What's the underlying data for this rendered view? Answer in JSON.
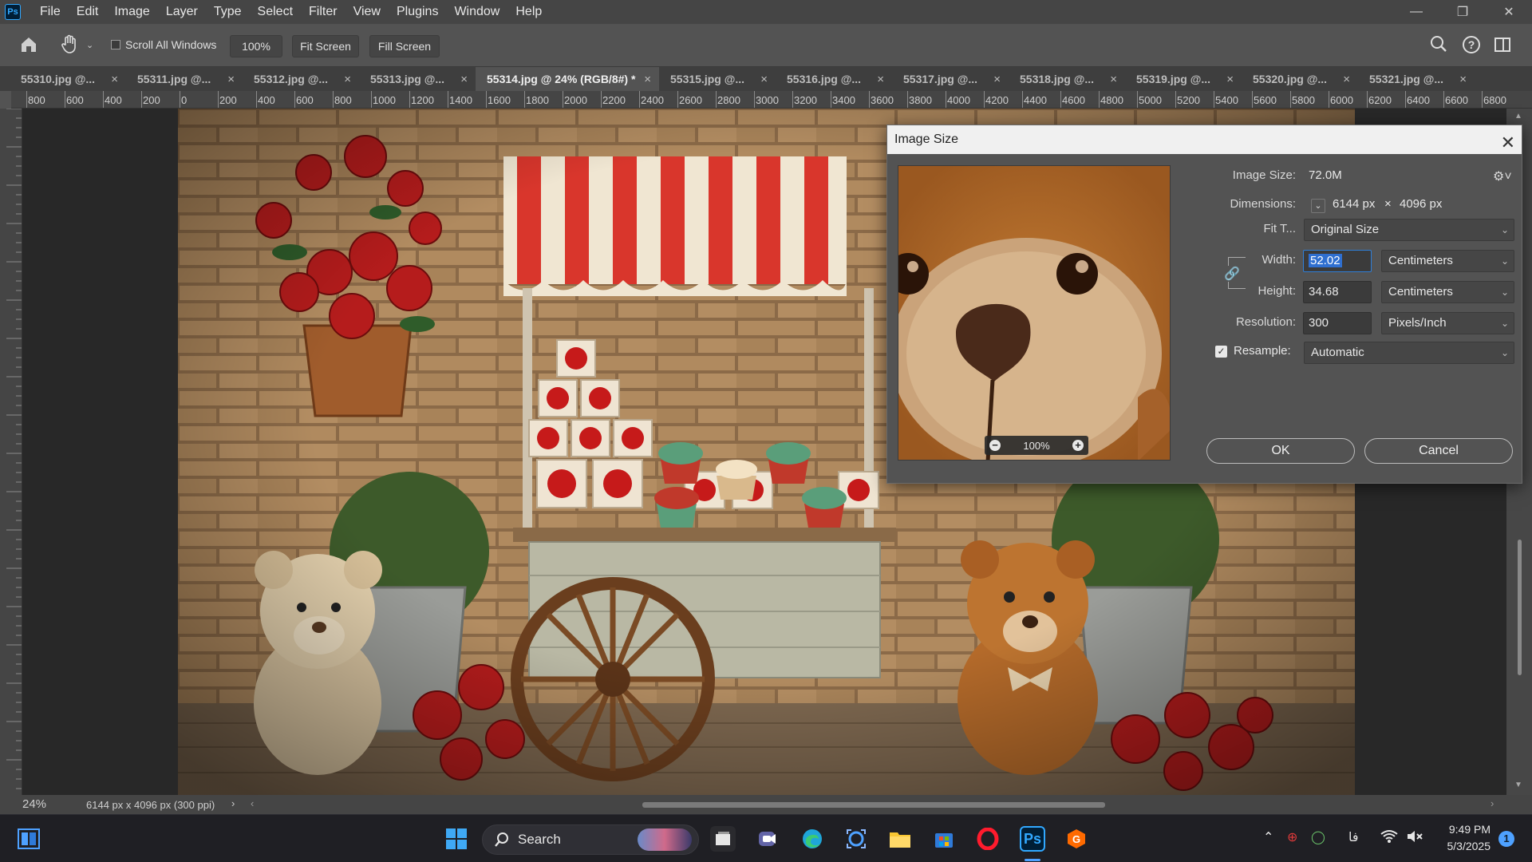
{
  "menubar": {
    "logo": "Ps",
    "items": [
      "File",
      "Edit",
      "Image",
      "Layer",
      "Type",
      "Select",
      "Filter",
      "View",
      "Plugins",
      "Window",
      "Help"
    ]
  },
  "options": {
    "scroll_all_windows": "Scroll All Windows",
    "zoom_100": "100%",
    "fit_screen": "Fit Screen",
    "fill_screen": "Fill Screen"
  },
  "tabs": [
    {
      "label": "55310.jpg @...",
      "active": false
    },
    {
      "label": "55311.jpg @...",
      "active": false
    },
    {
      "label": "55312.jpg @...",
      "active": false
    },
    {
      "label": "55313.jpg @...",
      "active": false
    },
    {
      "label": "55314.jpg @ 24% (RGB/8#) *",
      "active": true
    },
    {
      "label": "55315.jpg @...",
      "active": false
    },
    {
      "label": "55316.jpg @...",
      "active": false
    },
    {
      "label": "55317.jpg @...",
      "active": false
    },
    {
      "label": "55318.jpg @...",
      "active": false
    },
    {
      "label": "55319.jpg @...",
      "active": false
    },
    {
      "label": "55320.jpg @...",
      "active": false
    },
    {
      "label": "55321.jpg @...",
      "active": false
    }
  ],
  "ruler_h": [
    "800",
    "600",
    "400",
    "200",
    "0",
    "200",
    "400",
    "600",
    "800",
    "1000",
    "1200",
    "1400",
    "1600",
    "1800",
    "2000",
    "2200",
    "2400",
    "2600",
    "2800",
    "3000",
    "3200",
    "3400",
    "3600",
    "3800",
    "4000",
    "4200",
    "4400",
    "4600",
    "4800",
    "5000",
    "5200",
    "5400",
    "5600",
    "5800",
    "6000",
    "6200",
    "6400",
    "6600",
    "6800"
  ],
  "status": {
    "zoom": "24%",
    "doc_info": "6144 px x 4096 px (300 ppi)"
  },
  "dialog": {
    "title": "Image Size",
    "image_size_label": "Image Size:",
    "image_size_value": "72.0M",
    "dimensions_label": "Dimensions:",
    "dim_width": "6144 px",
    "dim_x": "×",
    "dim_height": "4096 px",
    "fit_to_label": "Fit T...",
    "fit_to_value": "Original Size",
    "width_label": "Width:",
    "width_value": "52.02",
    "width_unit": "Centimeters",
    "height_label": "Height:",
    "height_value": "34.68",
    "height_unit": "Centimeters",
    "resolution_label": "Resolution:",
    "resolution_value": "300",
    "resolution_unit": "Pixels/Inch",
    "resample_label": "Resample:",
    "resample_value": "Automatic",
    "preview_zoom": "100%",
    "ok": "OK",
    "cancel": "Cancel"
  },
  "taskbar": {
    "search": "Search",
    "time": "9:49 PM",
    "date": "5/3/2025",
    "lang": "فا",
    "notifications": "1"
  }
}
